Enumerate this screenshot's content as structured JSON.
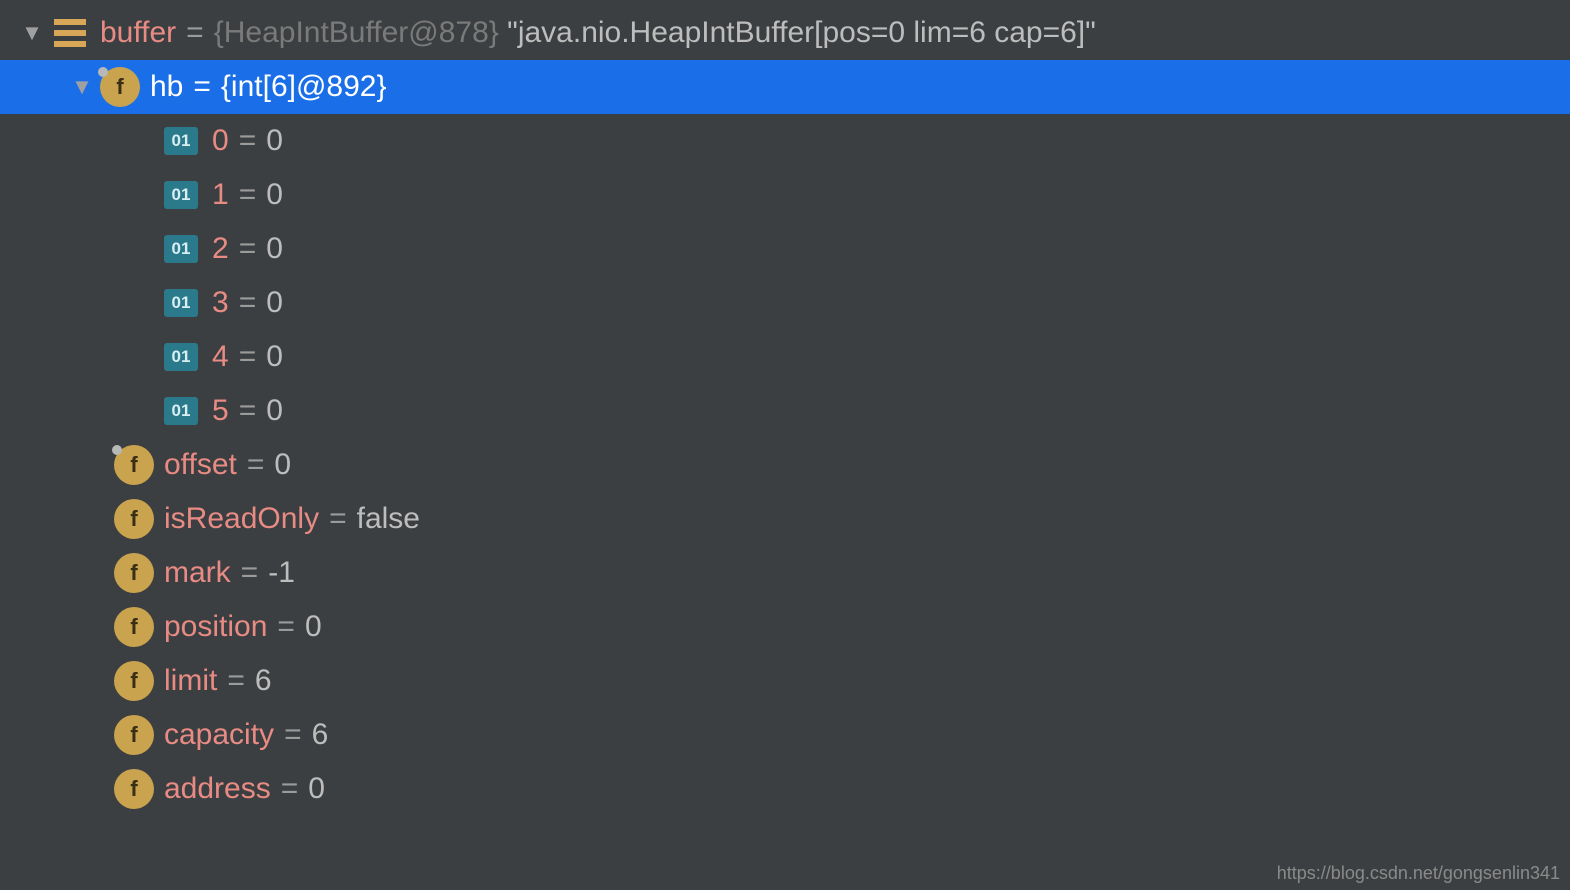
{
  "root": {
    "name": "buffer",
    "type": "{HeapIntBuffer@878}",
    "desc": "\"java.nio.HeapIntBuffer[pos=0 lim=6 cap=6]\""
  },
  "hb": {
    "name": "hb",
    "type": "{int[6]@892}",
    "items": [
      {
        "idx": "0",
        "val": "0"
      },
      {
        "idx": "1",
        "val": "0"
      },
      {
        "idx": "2",
        "val": "0"
      },
      {
        "idx": "3",
        "val": "0"
      },
      {
        "idx": "4",
        "val": "0"
      },
      {
        "idx": "5",
        "val": "0"
      }
    ]
  },
  "fields": [
    {
      "name": "offset",
      "val": "0",
      "dot": true
    },
    {
      "name": "isReadOnly",
      "val": "false",
      "dot": false
    },
    {
      "name": "mark",
      "val": "-1",
      "dot": false
    },
    {
      "name": "position",
      "val": "0",
      "dot": false
    },
    {
      "name": "limit",
      "val": "6",
      "dot": false
    },
    {
      "name": "capacity",
      "val": "6",
      "dot": false
    },
    {
      "name": "address",
      "val": "0",
      "dot": false
    }
  ],
  "glyphs": {
    "eq": " = ",
    "field_letter": "f",
    "prim_label": "01"
  },
  "watermark": "https://blog.csdn.net/gongsenlin341"
}
